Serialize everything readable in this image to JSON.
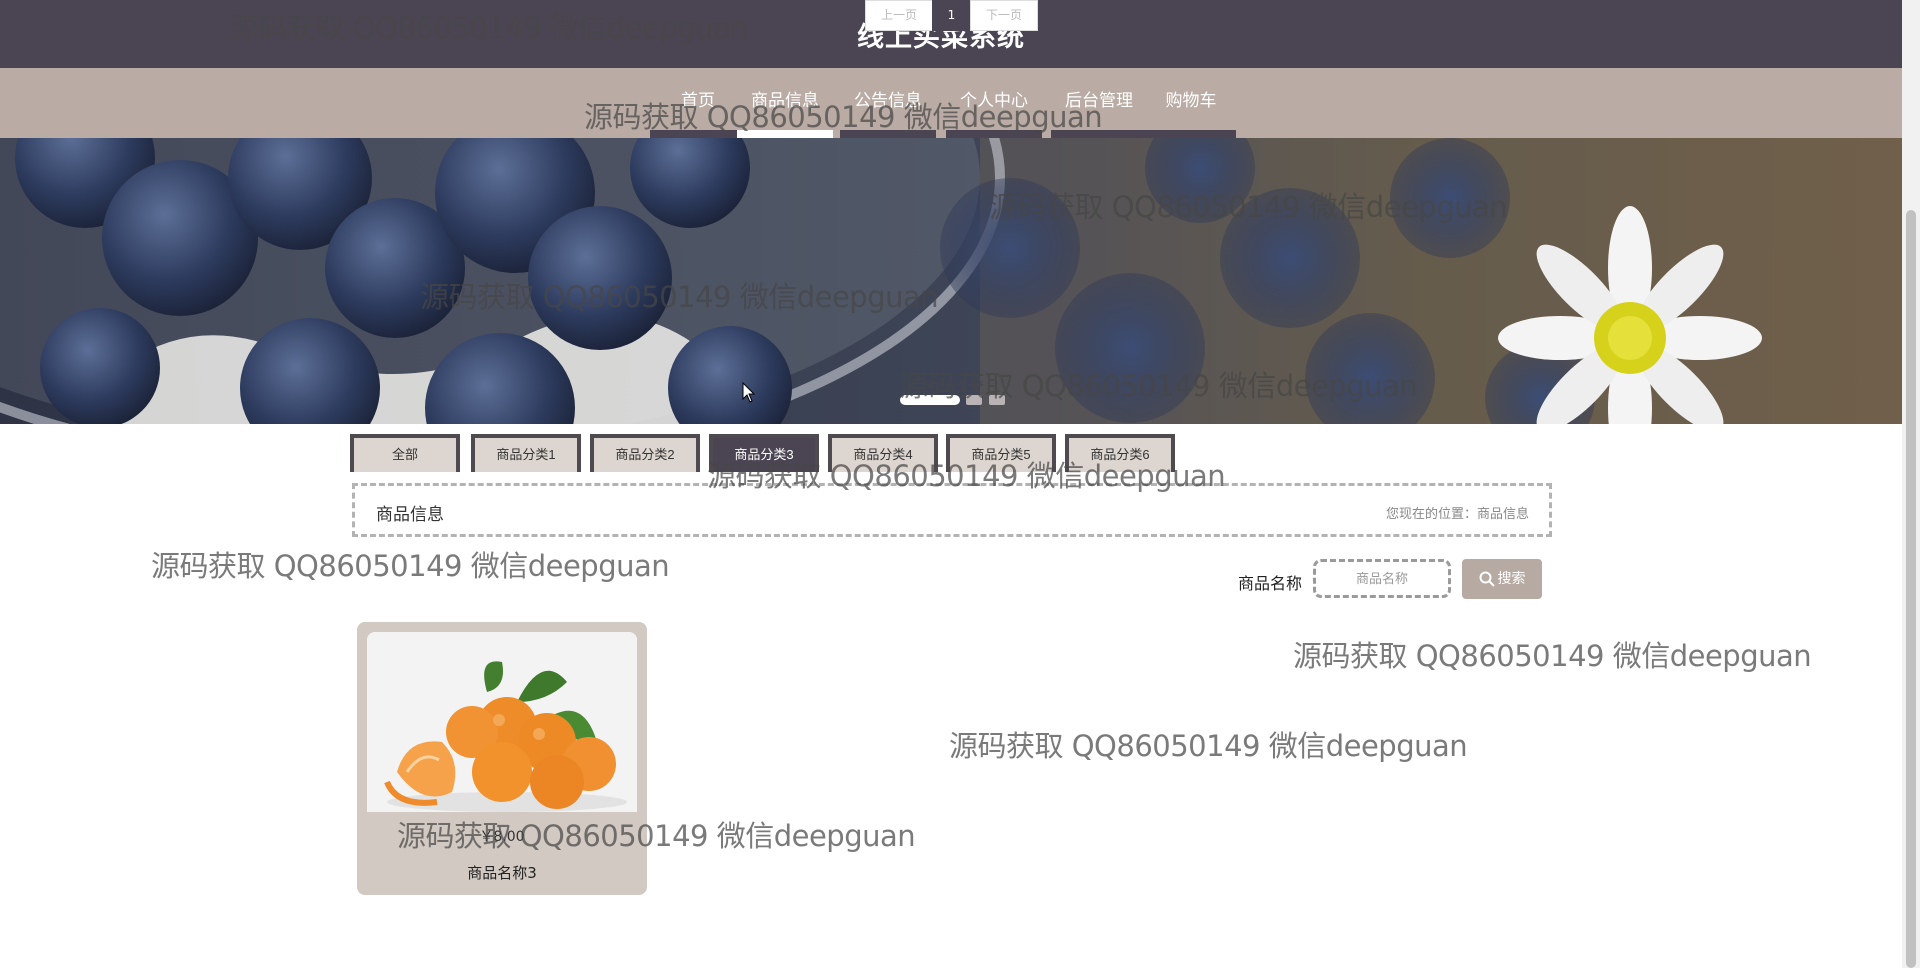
{
  "header": {
    "title": "线上买菜系统"
  },
  "nav": {
    "items": [
      {
        "label": "首页"
      },
      {
        "label": "商品信息"
      },
      {
        "label": "公告信息"
      },
      {
        "label": "个人中心"
      },
      {
        "label": "后台管理"
      },
      {
        "label": "购物车"
      }
    ],
    "active_index": 1
  },
  "banner": {
    "slide_count": 3,
    "active_slide": 1
  },
  "categories": {
    "tabs": [
      {
        "label": "全部"
      },
      {
        "label": "商品分类1"
      },
      {
        "label": "商品分类2"
      },
      {
        "label": "商品分类3"
      },
      {
        "label": "商品分类4"
      },
      {
        "label": "商品分类5"
      },
      {
        "label": "商品分类6"
      }
    ],
    "active_index": 3
  },
  "breadcrumb": {
    "title": "商品信息",
    "location": "您现在的位置：商品信息"
  },
  "search": {
    "label": "商品名称",
    "placeholder": "商品名称",
    "button_label": "搜索"
  },
  "products": [
    {
      "price": "￥8.00",
      "name": "商品名称3"
    }
  ],
  "pagination": {
    "prev_label": "上一页",
    "current_page": "1",
    "next_label": "下一页"
  },
  "watermark": {
    "text": "源码获取 QQ86050149 微信deepguan"
  },
  "colors": {
    "header_bg": "#4b4452",
    "nav_bg": "#baaca4",
    "card_bg": "#d2c9c2",
    "search_button_bg": "#b6aaa3"
  },
  "icons": {
    "search": "search-icon",
    "cursor": "mouse-cursor-icon"
  }
}
